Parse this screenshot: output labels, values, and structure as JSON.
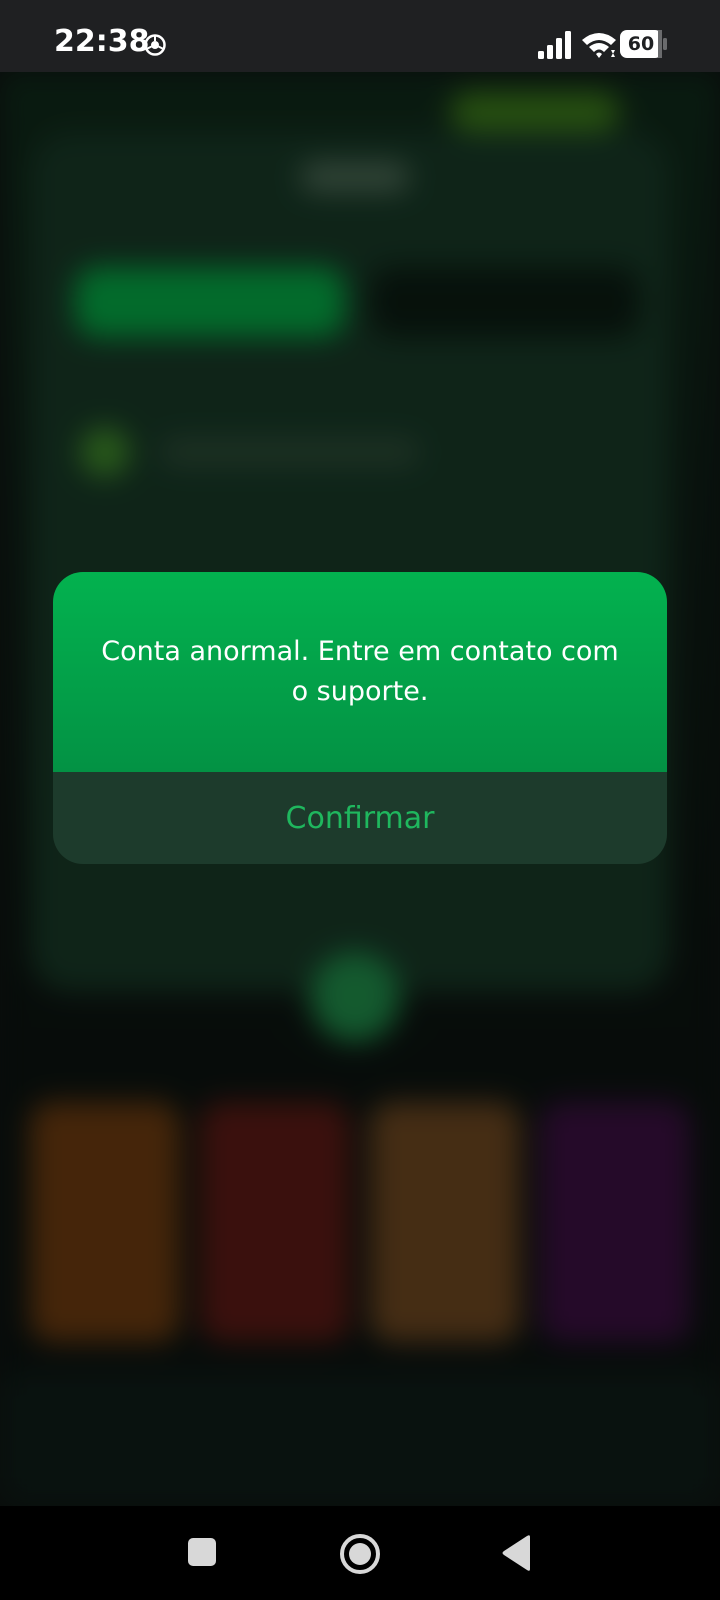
{
  "status_bar": {
    "time": "22:38",
    "battery_level": "60",
    "icons": [
      "chrome-icon",
      "signal-icon",
      "wifi-icon",
      "battery-icon"
    ]
  },
  "dialog": {
    "message": "Conta anormal. Entre em contato com o suporte.",
    "confirm_label": "Confirmar"
  },
  "navigation_bar": {
    "icons": [
      "recents-square-icon",
      "home-circle-icon",
      "back-triangle-icon"
    ]
  },
  "colors": {
    "dialog_green_top": "#03b24f",
    "dialog_green_bottom": "#039244",
    "dialog_footer": "#1d3b2c",
    "confirm_text": "#1fb75e",
    "status_bar": "#1f2022"
  }
}
